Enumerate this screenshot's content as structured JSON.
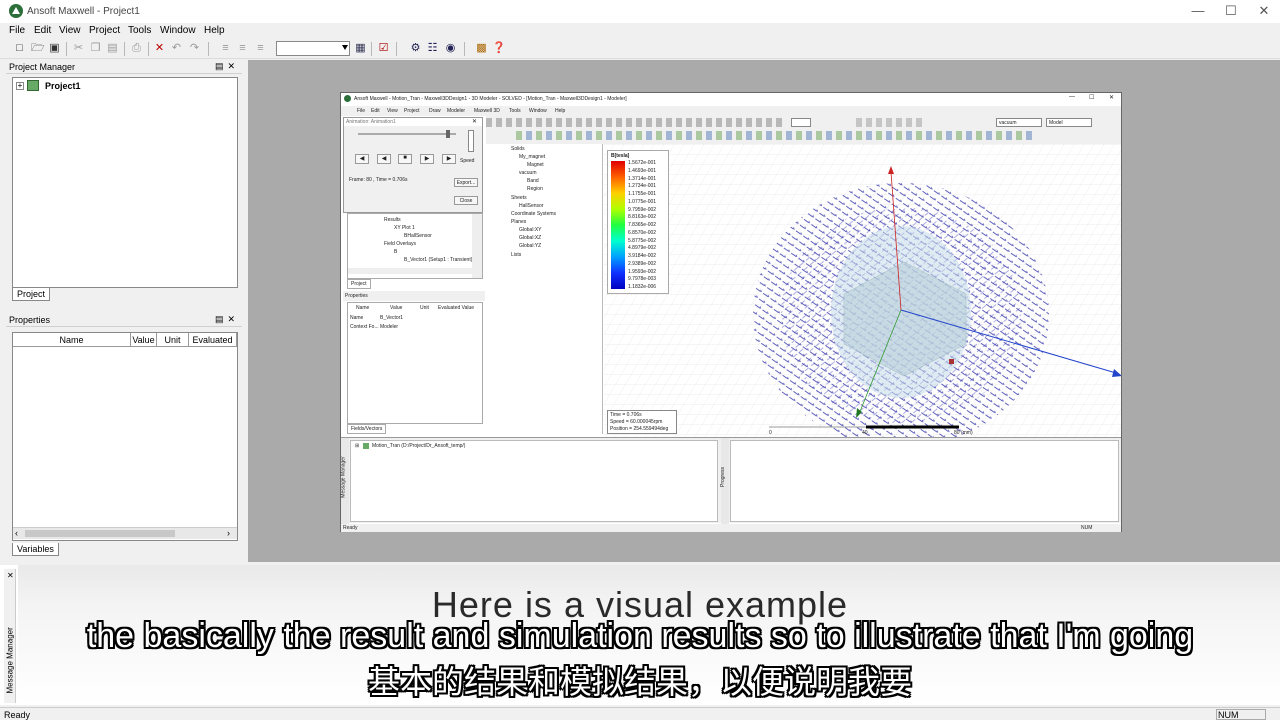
{
  "window": {
    "title": "Ansoft Maxwell - Project1"
  },
  "menu": [
    "File",
    "Edit",
    "View",
    "Project",
    "Tools",
    "Window",
    "Help"
  ],
  "project_manager": {
    "title": "Project Manager",
    "root": "Project1",
    "tab": "Project"
  },
  "properties": {
    "title": "Properties",
    "columns": [
      "Name",
      "Value",
      "Unit",
      "Evaluated"
    ],
    "tab": "Variables"
  },
  "inner_window": {
    "title": "Ansoft Maxwell - Motion_Tran - Maxwell3DDesign1 - 3D Modeler - SOLVED - [Motion_Tran - Maxwell3DDesign1 - Modeler]",
    "menu": [
      "File",
      "Edit",
      "View",
      "Project",
      "Draw",
      "Modeler",
      "Maxwell 3D",
      "Tools",
      "Window",
      "Help"
    ],
    "combo_material": "vacuum",
    "combo_model": "Model",
    "animation": {
      "title": "Animation: Animation1",
      "frame_text": "Frame: 80 , Time = 0.706s",
      "speed_label": "Speed",
      "export_label": "Export...",
      "close_label": "Close"
    },
    "project_tree": [
      "Results",
      "XY Plot 1",
      "BHallSensor",
      "Field Overlays",
      "B",
      "B_Vector1 (Setup1 : Transient)"
    ],
    "project_tab": "Project",
    "props_panel": {
      "title": "Properties",
      "columns": [
        "Name",
        "Value",
        "Unit",
        "Evaluated Value"
      ],
      "rows": [
        [
          "Name",
          "B_Vector1",
          "",
          ""
        ],
        [
          "Context Fo...",
          "Modeler",
          "",
          ""
        ]
      ],
      "tab": "Fields/Vectors"
    },
    "model_tree": [
      "Solids",
      "My_magnet",
      "Magnet",
      "vacuum",
      "Band",
      "Region",
      "Sheets",
      "HallSensor",
      "Coordinate Systems",
      "Planes",
      "Global:XY",
      "Global:XZ",
      "Global:YZ",
      "Lists"
    ],
    "legend": {
      "title": "B[tesla]",
      "values": [
        "1.5672e-001",
        "1.4693e-001",
        "1.3714e-001",
        "1.2734e-001",
        "1.1755e-001",
        "1.0775e-001",
        "9.7959e-002",
        "8.8163e-002",
        "7.8365e-002",
        "6.8570e-002",
        "5.8775e-002",
        "4.8979e-002",
        "3.9184e-002",
        "2.9389e-002",
        "1.9593e-002",
        "9.7978e-003",
        "1.1832e-006"
      ]
    },
    "info_box": {
      "time": "Time = 0.706s",
      "speed": "Speed = 60.000045rpm",
      "position": "Position = 254.559494deg"
    },
    "scale_labels": [
      "0",
      "40",
      "80 (mm)"
    ],
    "message_item": "Motion_Tran (D:/Project/Dr_Ansoft_temp/)",
    "msg_label": "Message Manager",
    "progress_label": "Progress",
    "status": "Ready",
    "num": "NUM"
  },
  "bottom": {
    "msg_label": "Message Manager",
    "status": "Ready",
    "num": "NUM"
  },
  "subtitles": {
    "line0": "Here is a visual example",
    "line1": "the basically the result and simulation results so to illustrate that I'm going",
    "line2": "基本的结果和模拟结果，以便说明我要"
  },
  "colors": {
    "accent_green": "#2b6e3a",
    "workspace_gray": "#aaaaaa",
    "vector_blue": "#1a1aa0"
  }
}
